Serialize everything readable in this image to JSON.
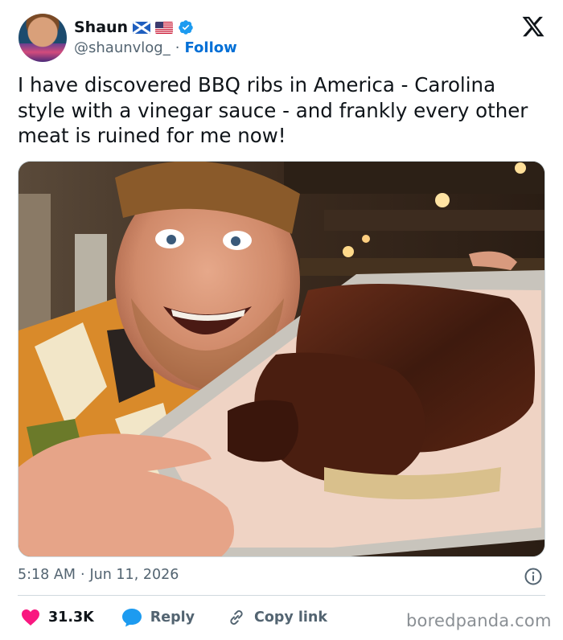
{
  "tweet": {
    "author": {
      "name": "Shaun",
      "handle": "@shaunvlog_",
      "follow_label": "Follow",
      "flags": [
        "scotland-flag",
        "us-flag"
      ],
      "verified": true
    },
    "separator": "·",
    "text": "I have discovered BBQ ribs in America - Carolina style with a vinegar sauce - and frankly every other meat is ruined for me now!",
    "time": "5:18 AM",
    "date": "Jun 11, 2026",
    "actions": {
      "likes": "31.3K",
      "reply_label": "Reply",
      "copy_link_label": "Copy link"
    }
  },
  "watermark": "boredpanda.com",
  "colors": {
    "link_blue": "#006fd6",
    "verified_blue": "#1d9bf0",
    "like_pink": "#f91880",
    "muted_gray": "#536471"
  },
  "icons": [
    "x-logo-icon",
    "verified-icon",
    "info-icon",
    "heart-icon",
    "reply-bubble-icon",
    "link-icon"
  ]
}
